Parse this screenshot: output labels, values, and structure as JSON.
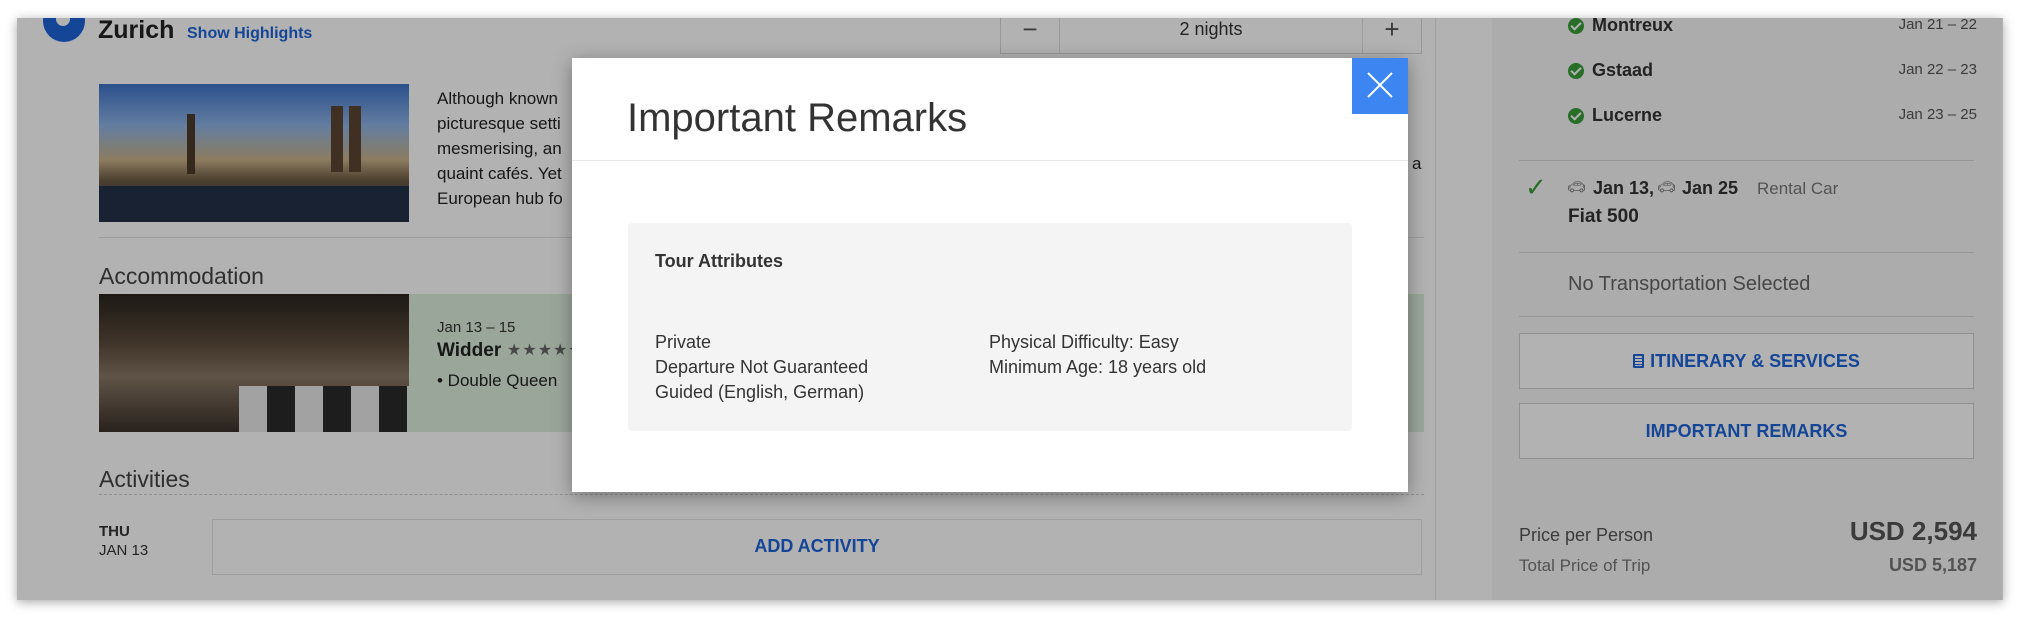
{
  "page": {
    "city": "Zurich",
    "show_highlights": "Show Highlights",
    "nights": "2 nights",
    "minus": "−",
    "plus": "+",
    "description_lines": [
      "Although known",
      "picturesque setti",
      "mesmerising, an",
      "quaint cafés. Yet",
      "European hub fo"
    ],
    "description_tail": "a",
    "accommodation_heading": "Accommodation",
    "hotel": {
      "dates": "Jan 13 – 15",
      "name": "Widder",
      "stars": "★★★★★",
      "room": "• Double Queen"
    },
    "activities_heading": "Activities",
    "day": {
      "weekday": "THU",
      "date": "JAN 13"
    },
    "add_activity": "ADD ACTIVITY"
  },
  "sidebar": {
    "stops": [
      {
        "name": "Montreux",
        "dates": "Jan 21 – 22"
      },
      {
        "name": "Gstaad",
        "dates": "Jan 22 – 23"
      },
      {
        "name": "Lucerne",
        "dates": "Jan 23 – 25"
      }
    ],
    "rental": {
      "start": "Jan 13,",
      "end": "Jan 25",
      "type": "Rental Car",
      "car": "Fiat 500"
    },
    "no_transport": "No Transportation Selected",
    "itinerary_button": "ITINERARY & SERVICES",
    "remarks_button": "IMPORTANT REMARKS",
    "price_per_person_label": "Price per Person",
    "price_per_person": "USD 2,594",
    "total_price_label": "Total Price of Trip",
    "total_price": "USD 5,187"
  },
  "modal": {
    "title": "Important Remarks",
    "card_title": "Tour Attributes",
    "attributes_left": [
      "Private",
      "Departure Not Guaranteed",
      "Guided (English, German)"
    ],
    "attributes_right": [
      "Physical Difficulty: Easy",
      "Minimum Age: 18 years old"
    ]
  },
  "colors": {
    "accent": "#1e64d8",
    "close_button": "#3d86f2",
    "check": "#3a9e3a",
    "accommodation_bg": "#dfeedd"
  },
  "icons": [
    "location-pin-icon",
    "check-circle-icon",
    "check-icon",
    "car-icon",
    "document-icon",
    "close-icon"
  ]
}
